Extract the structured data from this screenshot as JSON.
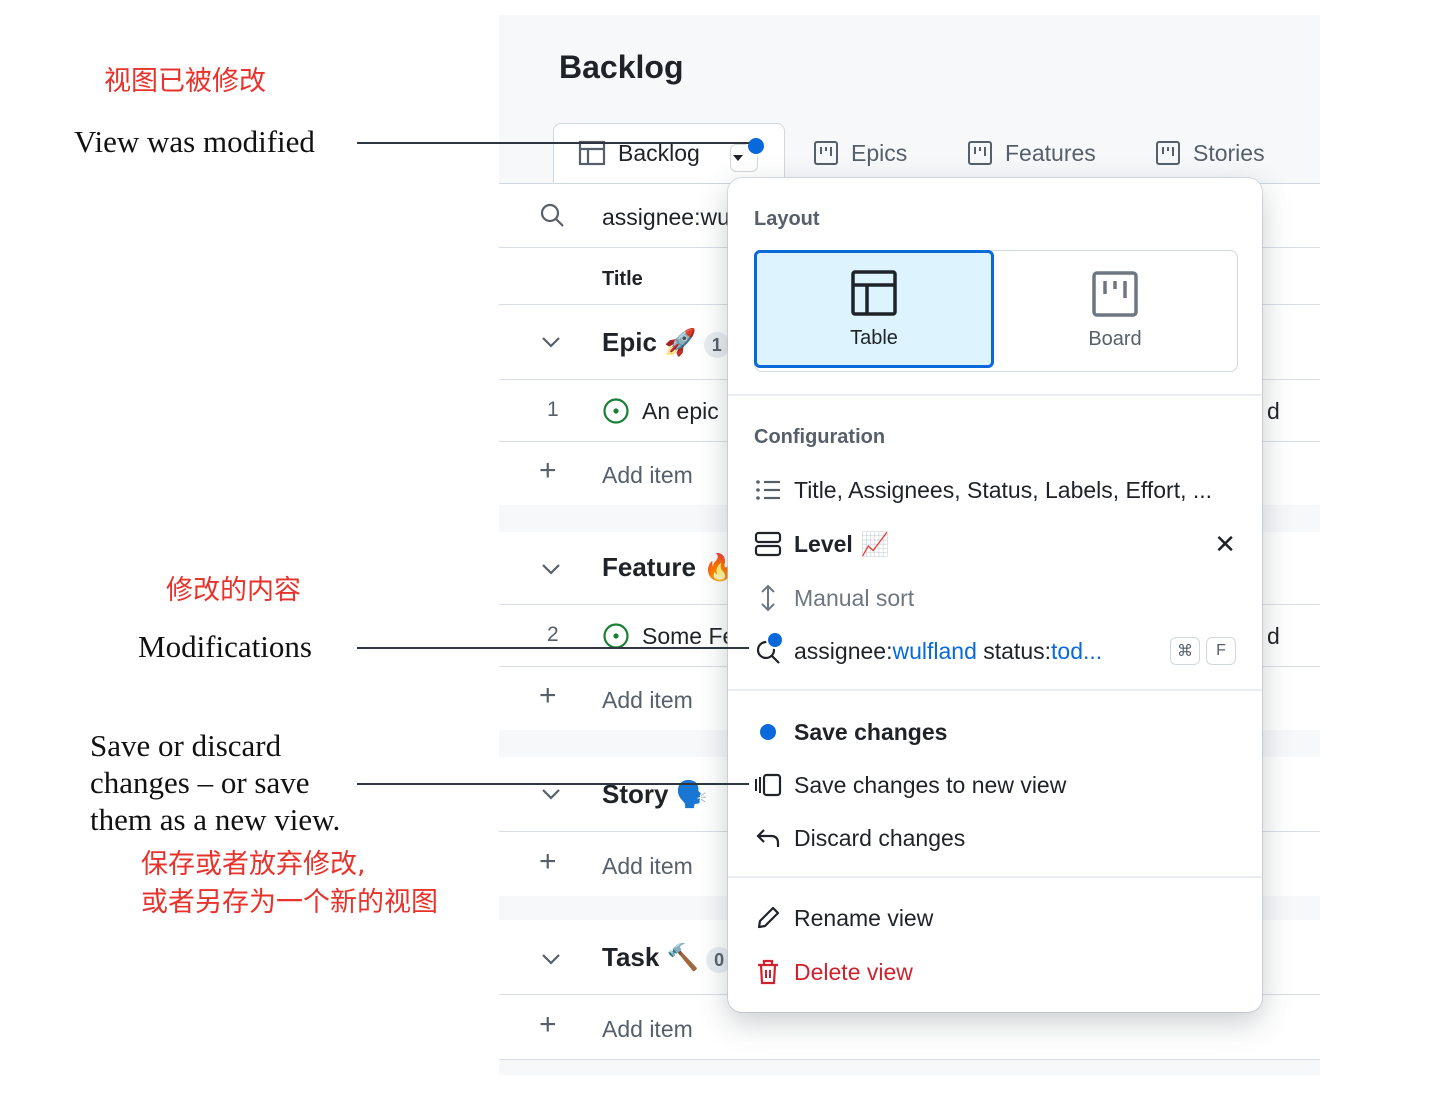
{
  "annotations": {
    "modified_cn": "视图已被修改",
    "modified_en": "View was modified",
    "mods_cn": "修改的内容",
    "mods_en": "Modifications",
    "save_en": "Save or discard changes – or save them as a new view.",
    "save_cn_1": "保存或者放弃修改,",
    "save_cn_2": "或者另存为一个新的视图"
  },
  "header": {
    "title": "Backlog"
  },
  "tabs": [
    {
      "label": "Backlog",
      "active": true,
      "icon": "table-icon",
      "modified": true
    },
    {
      "label": "Epics",
      "icon": "board-icon"
    },
    {
      "label": "Features",
      "icon": "board-icon"
    },
    {
      "label": "Stories",
      "icon": "board-icon"
    }
  ],
  "filter": {
    "value": "assignee:wu"
  },
  "table": {
    "column_title": "Title",
    "add_item_label": "Add item",
    "groups": [
      {
        "name": "Epic",
        "emoji": "🚀",
        "count": "1",
        "items": [
          {
            "num": "1",
            "title": "An epic",
            "trailing": "d"
          }
        ]
      },
      {
        "name": "Feature",
        "emoji": "🔥",
        "count": "",
        "items": [
          {
            "num": "2",
            "title": "Some Fe",
            "trailing": "d"
          }
        ]
      },
      {
        "name": "Story",
        "emoji": "🗣️",
        "count": "",
        "items": []
      },
      {
        "name": "Task",
        "emoji": "🔨",
        "count": "0",
        "items": []
      }
    ]
  },
  "menu": {
    "layout_title": "Layout",
    "layout_options": [
      {
        "label": "Table",
        "selected": true
      },
      {
        "label": "Board",
        "selected": false
      }
    ],
    "config_title": "Configuration",
    "fields": "Title, Assignees, Status, Labels, Effort, ...",
    "group_by": {
      "label": "Level",
      "emoji": "📈"
    },
    "sort": "Manual sort",
    "filter": {
      "key1": "assignee:",
      "val1": "wulfland",
      "key2": " status:",
      "val2": "tod...",
      "shortcut": [
        "⌘",
        "F"
      ]
    },
    "save_changes": "Save changes",
    "save_new_view": "Save changes to new view",
    "discard": "Discard changes",
    "rename": "Rename view",
    "delete": "Delete view"
  },
  "colors": {
    "accent": "#0969da",
    "danger": "#cf222e",
    "annotation": "#e8322c",
    "success": "#1a7f37"
  }
}
